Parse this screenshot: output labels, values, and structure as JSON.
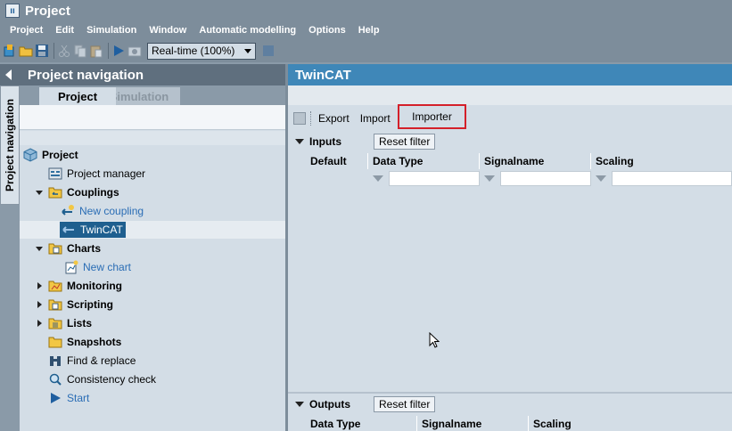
{
  "window": {
    "title": "Project"
  },
  "menu": [
    "Project",
    "Edit",
    "Simulation",
    "Window",
    "Automatic modelling",
    "Options",
    "Help"
  ],
  "toolbar": {
    "speed_value": "Real-time (100%)"
  },
  "left_panel": {
    "header": "Project navigation",
    "vertical_tab": "Project navigation",
    "tabs": [
      "Project",
      "Simulation"
    ],
    "tree": [
      {
        "label": "Project",
        "bold": true,
        "icon": "cube-icon"
      },
      {
        "label": "Project manager",
        "bold": false,
        "icon": "manager-icon"
      },
      {
        "label": "Couplings",
        "bold": true,
        "icon": "folder-coupling-icon"
      },
      {
        "label": "New coupling",
        "bold": false,
        "icon": "new-coupling-icon"
      },
      {
        "label": "TwinCAT",
        "bold": false,
        "icon": "coupling-icon"
      },
      {
        "label": "Charts",
        "bold": true,
        "icon": "folder-chart-icon"
      },
      {
        "label": "New chart",
        "bold": false,
        "icon": "new-chart-icon"
      },
      {
        "label": "Monitoring",
        "bold": true,
        "icon": "folder-monitor-icon"
      },
      {
        "label": "Scripting",
        "bold": true,
        "icon": "folder-script-icon"
      },
      {
        "label": "Lists",
        "bold": true,
        "icon": "folder-list-icon"
      },
      {
        "label": "Snapshots",
        "bold": true,
        "icon": "folder-snapshot-icon"
      },
      {
        "label": "Find & replace",
        "bold": false,
        "icon": "binoculars-icon"
      },
      {
        "label": "Consistency check",
        "bold": false,
        "icon": "magnifier-icon"
      },
      {
        "label": "Start",
        "bold": false,
        "icon": "play-icon"
      }
    ]
  },
  "right_panel": {
    "header": "TwinCAT",
    "toolbar": {
      "export": "Export",
      "import": "Import",
      "importer": "Importer"
    },
    "inputs": {
      "title": "Inputs",
      "reset": "Reset filter",
      "columns": [
        "Default",
        "Data Type",
        "Signalname",
        "Scaling"
      ]
    },
    "outputs": {
      "title": "Outputs",
      "reset": "Reset filter",
      "columns": [
        "Data Type",
        "Signalname",
        "Scaling"
      ]
    }
  },
  "colors": {
    "chrome": "#7d8d9b",
    "panel": "#d3dde6",
    "accent_header": "#3f87b8",
    "selection": "#1f5f8f",
    "highlight": "#d4202a"
  }
}
